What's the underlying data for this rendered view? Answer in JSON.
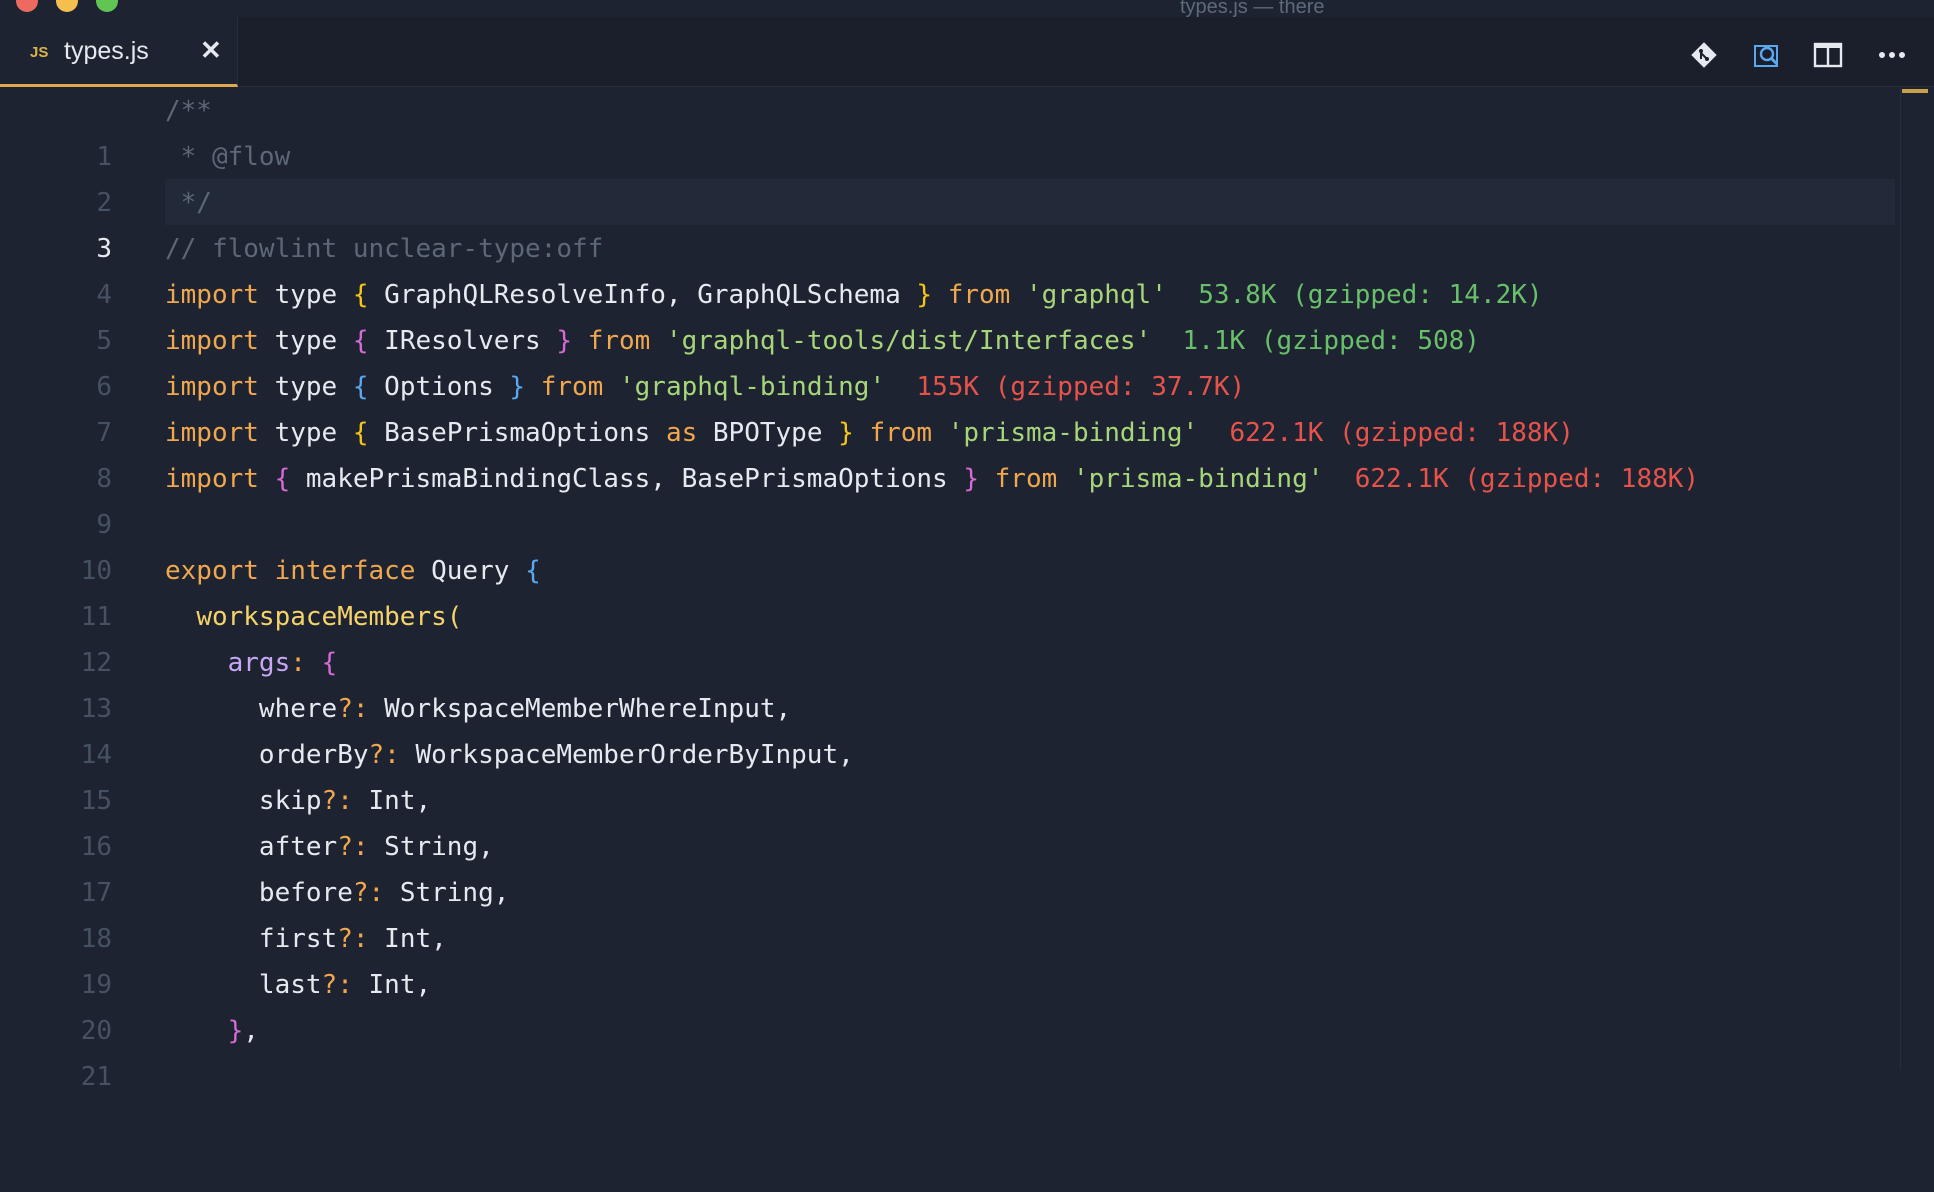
{
  "window": {
    "title": "types.js — there"
  },
  "tab": {
    "lang_badge": "JS",
    "name": "types.js",
    "close_glyph": "✕"
  },
  "toolbar": {
    "icons": [
      "git-compare-icon",
      "open-preview-icon",
      "split-editor-icon",
      "more-actions-icon"
    ]
  },
  "editor": {
    "active_line": 3,
    "colors": {
      "keyword": "#f0a74e",
      "string": "#a7d67a",
      "comment": "#5c6778",
      "size_ok": "#69c06a",
      "size_warn": "#e5534b"
    },
    "lines": [
      {
        "no": "1",
        "comment": "/**"
      },
      {
        "no": "2",
        "comment": " * @flow"
      },
      {
        "no": "3",
        "comment": " */"
      },
      {
        "no": "4",
        "comment": "// flowlint unclear-type:off"
      },
      {
        "no": "5",
        "kw": "import",
        "type_kw": "type",
        "open": "{",
        "names": "GraphQLResolveInfo, GraphQLSchema",
        "close": "}",
        "from": "from",
        "module": "'graphql'",
        "size": "53.8K (gzipped: 14.2K)"
      },
      {
        "no": "6",
        "kw": "import",
        "type_kw": "type",
        "open": "{",
        "names": "IResolvers",
        "close": "}",
        "from": "from",
        "module": "'graphql-tools/dist/Interfaces'",
        "size": "1.1K (gzipped: 508)"
      },
      {
        "no": "7",
        "kw": "import",
        "type_kw": "type",
        "open": "{",
        "names": "Options",
        "close": "}",
        "from": "from",
        "module": "'graphql-binding'",
        "size": "155K (gzipped: 37.7K)"
      },
      {
        "no": "8",
        "kw": "import",
        "type_kw": "type",
        "open": "{",
        "names": "BasePrismaOptions",
        "as": "as",
        "alias": "BPOType",
        "close": "}",
        "from": "from",
        "module": "'prisma-binding'",
        "size": "622.1K (gzipped: 188K)"
      },
      {
        "no": "9",
        "kw": "import",
        "open": "{",
        "names": "makePrismaBindingClass, BasePrismaOptions",
        "close": "}",
        "from": "from",
        "module": "'prisma-binding'",
        "size": "622.1K (gzipped: 188K)"
      },
      {
        "no": "10"
      },
      {
        "no": "11",
        "kw1": "export",
        "kw2": "interface",
        "name": "Query",
        "open": "{"
      },
      {
        "no": "12",
        "indent": "  ",
        "fn": "workspaceMembers("
      },
      {
        "no": "13",
        "indent": "    ",
        "prop": "args",
        "punct": ":",
        "open": "{"
      },
      {
        "no": "14",
        "indent": "      ",
        "field": "where",
        "opt": "?:",
        "type": "WorkspaceMemberWhereInput,"
      },
      {
        "no": "15",
        "indent": "      ",
        "field": "orderBy",
        "opt": "?:",
        "type": "WorkspaceMemberOrderByInput,"
      },
      {
        "no": "16",
        "indent": "      ",
        "field": "skip",
        "opt": "?:",
        "type": "Int,"
      },
      {
        "no": "17",
        "indent": "      ",
        "field": "after",
        "opt": "?:",
        "type": "String,"
      },
      {
        "no": "18",
        "indent": "      ",
        "field": "before",
        "opt": "?:",
        "type": "String,"
      },
      {
        "no": "19",
        "indent": "      ",
        "field": "first",
        "opt": "?:",
        "type": "Int,"
      },
      {
        "no": "20",
        "indent": "      ",
        "field": "last",
        "opt": "?:",
        "type": "Int,"
      },
      {
        "no": "21",
        "indent": "    ",
        "close": "}",
        "tail": ","
      }
    ]
  }
}
